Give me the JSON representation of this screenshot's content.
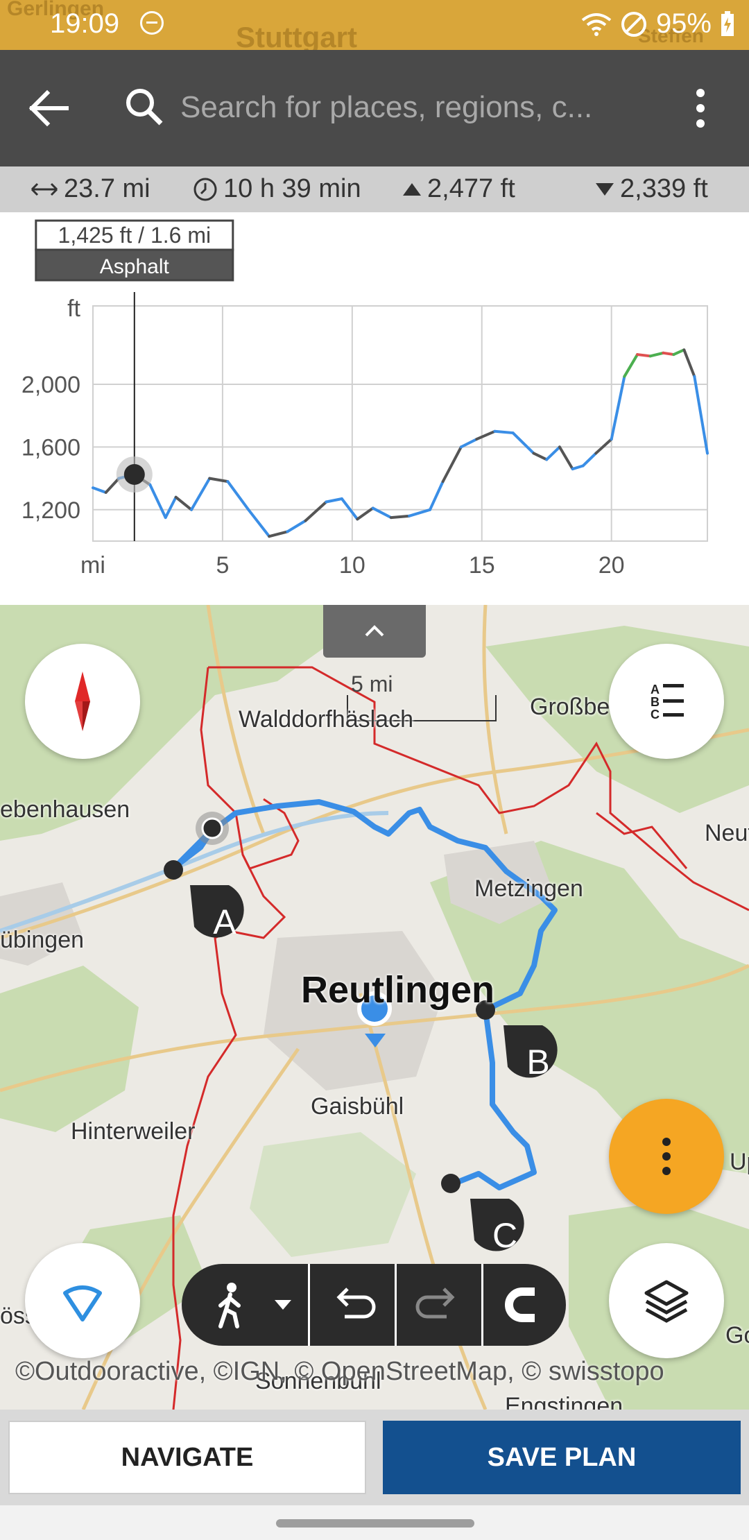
{
  "status_bar": {
    "time": "19:09",
    "battery": "95%",
    "background_map_labels": [
      "Gerlingen",
      "Stuttgart",
      "Steffen"
    ]
  },
  "toolbar": {
    "search_placeholder": "Search for places, regions, c..."
  },
  "route_stats": {
    "distance": "23.7 mi",
    "duration": "10 h 39 min",
    "ascent": "2,477 ft",
    "descent": "2,339 ft"
  },
  "elevation": {
    "tooltip_value": "1,425 ft / 1.6 mi",
    "tooltip_surface": "Asphalt"
  },
  "chart_data": {
    "type": "line",
    "ylabel": "ft",
    "xlabel": "mi",
    "x_ticks": [
      "5",
      "10",
      "15",
      "20"
    ],
    "y_ticks": [
      "2,000",
      "1,600",
      "1,200"
    ],
    "xlim": [
      0,
      23.7
    ],
    "ylim": [
      1000,
      2500
    ],
    "grid": true,
    "cursor_x": 1.6,
    "cursor_y": 1425,
    "series": [
      {
        "x": [
          0,
          0.5,
          1,
          1.6,
          2.2,
          2.8,
          3.2,
          3.8,
          4.5,
          5.2,
          6,
          6.8,
          7.5,
          8.2,
          9,
          9.6,
          10.2,
          10.8,
          11.5,
          12.2,
          13,
          13.5,
          14.2,
          14.8,
          15.5,
          16.2,
          17,
          17.5,
          18,
          18.5,
          18.9,
          19.4,
          20,
          20.5,
          21,
          21.5,
          22,
          22.4,
          22.8,
          23.2,
          23.7
        ],
        "y": [
          1340,
          1310,
          1400,
          1425,
          1360,
          1150,
          1280,
          1200,
          1400,
          1380,
          1200,
          1030,
          1060,
          1130,
          1250,
          1270,
          1140,
          1210,
          1150,
          1160,
          1200,
          1380,
          1600,
          1650,
          1700,
          1690,
          1560,
          1520,
          1600,
          1460,
          1480,
          1560,
          1650,
          2050,
          2190,
          2180,
          2200,
          2190,
          2220,
          2050,
          1560
        ]
      }
    ]
  },
  "map": {
    "places": [
      "Walddorfhäslach",
      "Großbett",
      "ebenhausen",
      "Neuf",
      "Metzingen",
      "übingen",
      "Reutlingen",
      "Gaisbühl",
      "Hinterweiler",
      "Up",
      "össi",
      "Sonnenbühl",
      "Engstingen",
      "Go"
    ],
    "scale_label": "5 mi",
    "waypoints": [
      "A",
      "B",
      "C"
    ],
    "attribution": "©Outdooractive, ©IGN, © OpenStreetMap, © swisstopo"
  },
  "buttons": {
    "navigate": "NAVIGATE",
    "save_plan": "SAVE PLAN"
  },
  "icons": {
    "back": "arrow-left-icon",
    "search": "search-icon",
    "overflow": "more-vertical-icon",
    "compass": "compass-icon",
    "legend": "list-abc-icon",
    "gps": "location-beacon-icon",
    "more": "more-vertical-icon",
    "layers": "layers-icon",
    "walk": "walking-person-icon",
    "undo": "undo-icon",
    "redo": "redo-icon",
    "snap": "magnet-icon"
  },
  "colors": {
    "accent_orange": "#f5a623",
    "primary_blue": "#13508f",
    "route_blue": "#3a8ee6",
    "boundary_red": "#d42a2a"
  }
}
